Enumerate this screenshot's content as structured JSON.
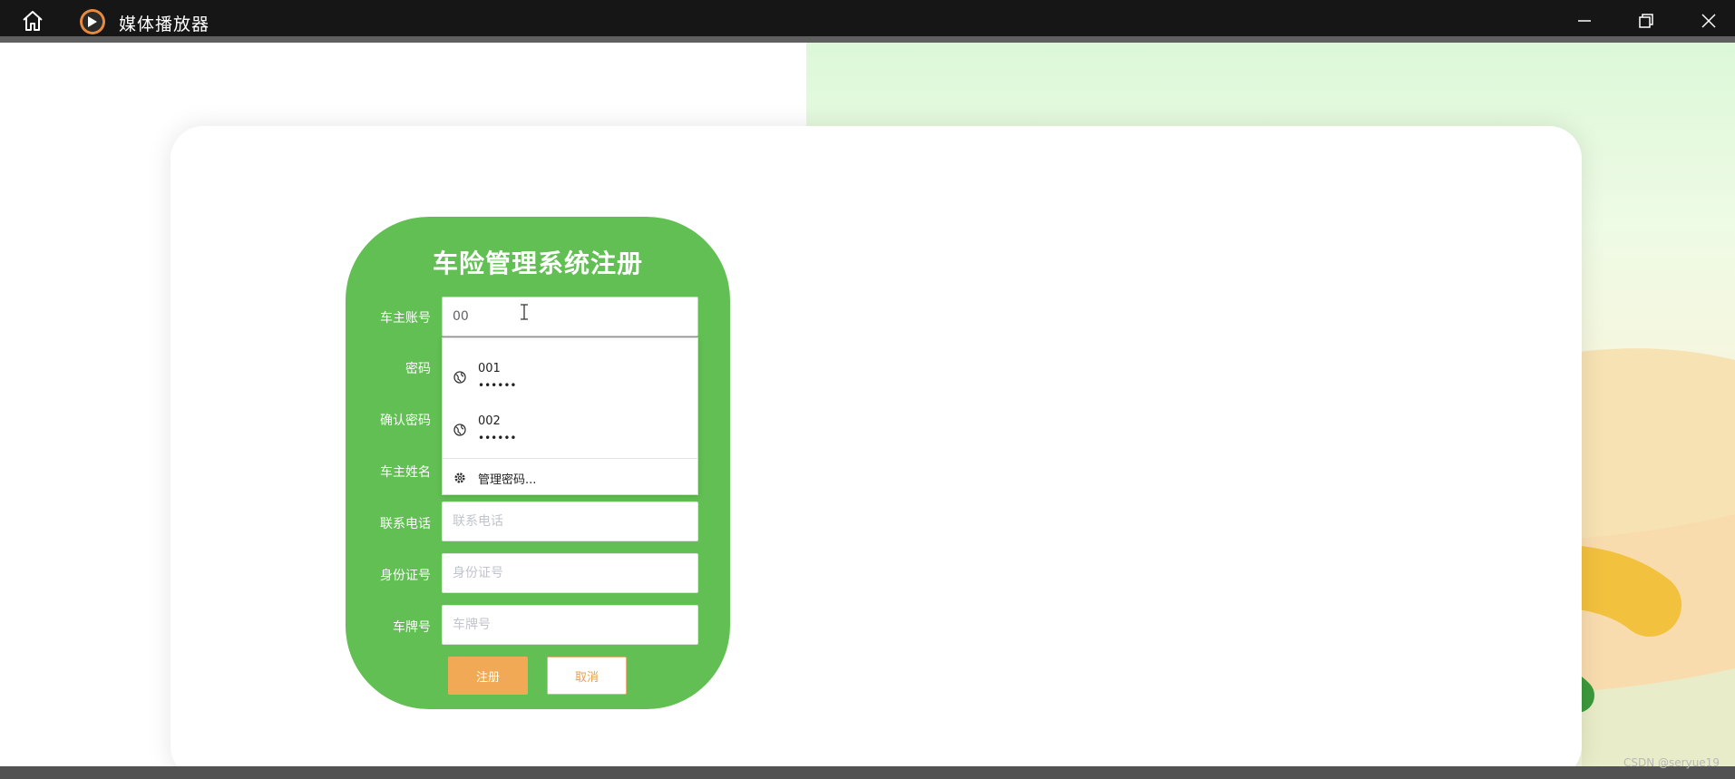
{
  "window": {
    "title": "媒体播放器",
    "home_icon": "home-icon",
    "app_icon": "play-circle-icon",
    "controls": [
      "minimize-icon",
      "restore-icon",
      "close-icon"
    ]
  },
  "form": {
    "title": "车险管理系统注册",
    "fields": [
      {
        "label": "车主账号",
        "value": "00",
        "placeholder": ""
      },
      {
        "label": "密码",
        "value": "",
        "placeholder": ""
      },
      {
        "label": "确认密码",
        "value": "",
        "placeholder": ""
      },
      {
        "label": "车主姓名",
        "value": "",
        "placeholder": ""
      },
      {
        "label": "联系电话",
        "value": "",
        "placeholder": "联系电话"
      },
      {
        "label": "身份证号",
        "value": "",
        "placeholder": "身份证号"
      },
      {
        "label": "车牌号",
        "value": "",
        "placeholder": "车牌号"
      }
    ],
    "register_label": "注册",
    "cancel_label": "取消"
  },
  "autocomplete": {
    "items": [
      {
        "username": "001",
        "password_mask": "••••••",
        "icon": "globe-icon"
      },
      {
        "username": "002",
        "password_mask": "••••••",
        "icon": "globe-icon"
      }
    ],
    "manage_label": "管理密码...",
    "manage_icon": "gear-icon"
  },
  "watermark": "CSDN @seryue19",
  "colors": {
    "form_green": "#62bf53",
    "register_orange": "#f1a955",
    "titlebar": "#161616"
  }
}
